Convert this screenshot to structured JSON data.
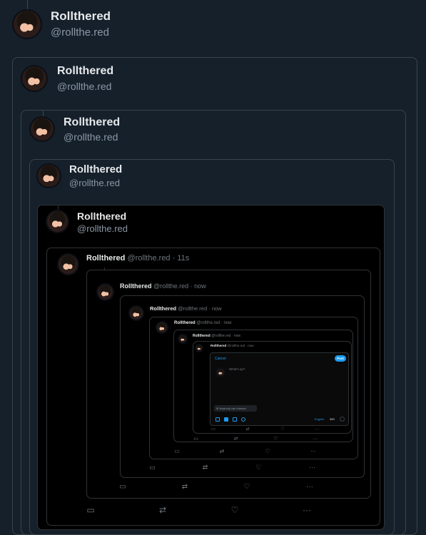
{
  "post": {
    "display_name": "Rollthered",
    "handle": "@rollthe.red"
  },
  "inline_posts": [
    {
      "display_name": "Rollthered",
      "meta": "@rollthe.red · 11s"
    },
    {
      "display_name": "Rollthered",
      "meta": "@rollthe.red · now"
    },
    {
      "display_name": "Rollthered",
      "meta": "@rollthe.red · now"
    },
    {
      "display_name": "Rollthered",
      "meta": "@rollthe.red · now"
    },
    {
      "display_name": "Rollthered",
      "meta": "@rollthe.red · now"
    },
    {
      "display_name": "Rollthered",
      "meta": "@rollthe.red · now"
    }
  ],
  "composer": {
    "cancel_label": "Cancel",
    "post_label": "Post",
    "placeholder": "What's up?",
    "chip_label": "Anybody can interact",
    "language": "English",
    "char_count": "300"
  },
  "icons": {
    "reply": "reply-icon",
    "repost": "repost-icon",
    "like": "like-icon",
    "more": "more-icon"
  },
  "colors": {
    "background": "#15202b",
    "card_border": "#38444d",
    "accent": "#1d9bf0"
  }
}
